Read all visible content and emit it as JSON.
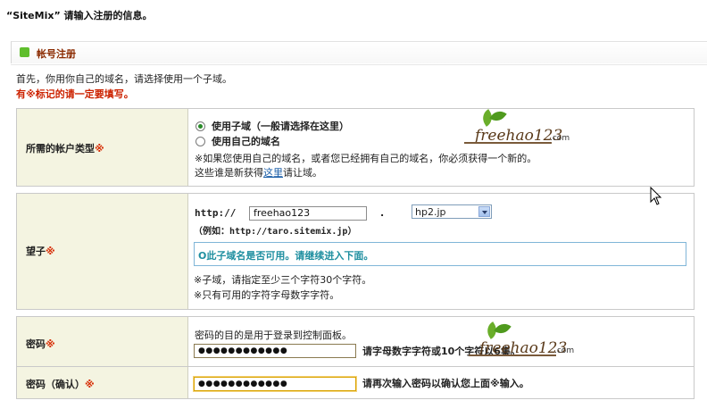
{
  "page": {
    "title": "“SiteMix” 请输入注册的信息。"
  },
  "section": {
    "title": "帐号注册"
  },
  "intro": {
    "text": "首先，你用你自己的域名，请选择使用一个子域。",
    "required_note": "有※标记的请一定要填写。"
  },
  "account_type": {
    "label": "所需的帐户类型",
    "required_mark": "※",
    "options": [
      {
        "label": "使用子域（一般请选择在这里）",
        "checked": true
      },
      {
        "label": "使用自己的域名",
        "checked": false
      }
    ],
    "note_line1": "※如果您使用自己的域名，或者您已经拥有自己的域名，你必须获得一个新的。",
    "note_line2_prefix": "这些谁是新获得",
    "note_link": "这里",
    "note_line2_suffix": "请让域。"
  },
  "subdomain": {
    "label": "望子",
    "required_mark": "※",
    "prefix": "http://",
    "value": "freehao123",
    "dot": ".",
    "domain_selected": "hp2.jp",
    "example": "（例如：http://taro.sitemix.jp）",
    "availability": "O此子域名是否可用。请继续进入下面。",
    "hint1": "※子域，请指定至少三个字符30个字符。",
    "hint2": "※只有可用的字符字母数字字符。"
  },
  "password": {
    "label": "密码",
    "required_mark": "※",
    "description": "密码的目的是用于登录到控制面板。",
    "value": "●●●●●●●●●●●●",
    "hint": "请字母数字字符或10个字符以6集。"
  },
  "password_confirm": {
    "label": "密码（确认）",
    "required_mark": "※",
    "value": "●●●●●●●●●●●●",
    "hint": "请再次输入密码以确认您上面※输入。"
  },
  "watermark": {
    "text": "freehao123",
    "suffix": ".com"
  },
  "colors": {
    "label_bg": "#f4f4e1",
    "required_red": "#d62a00",
    "section_title": "#8b2a00",
    "availability_text": "#1f8fa0",
    "section_icon": "#5fbe2d"
  }
}
